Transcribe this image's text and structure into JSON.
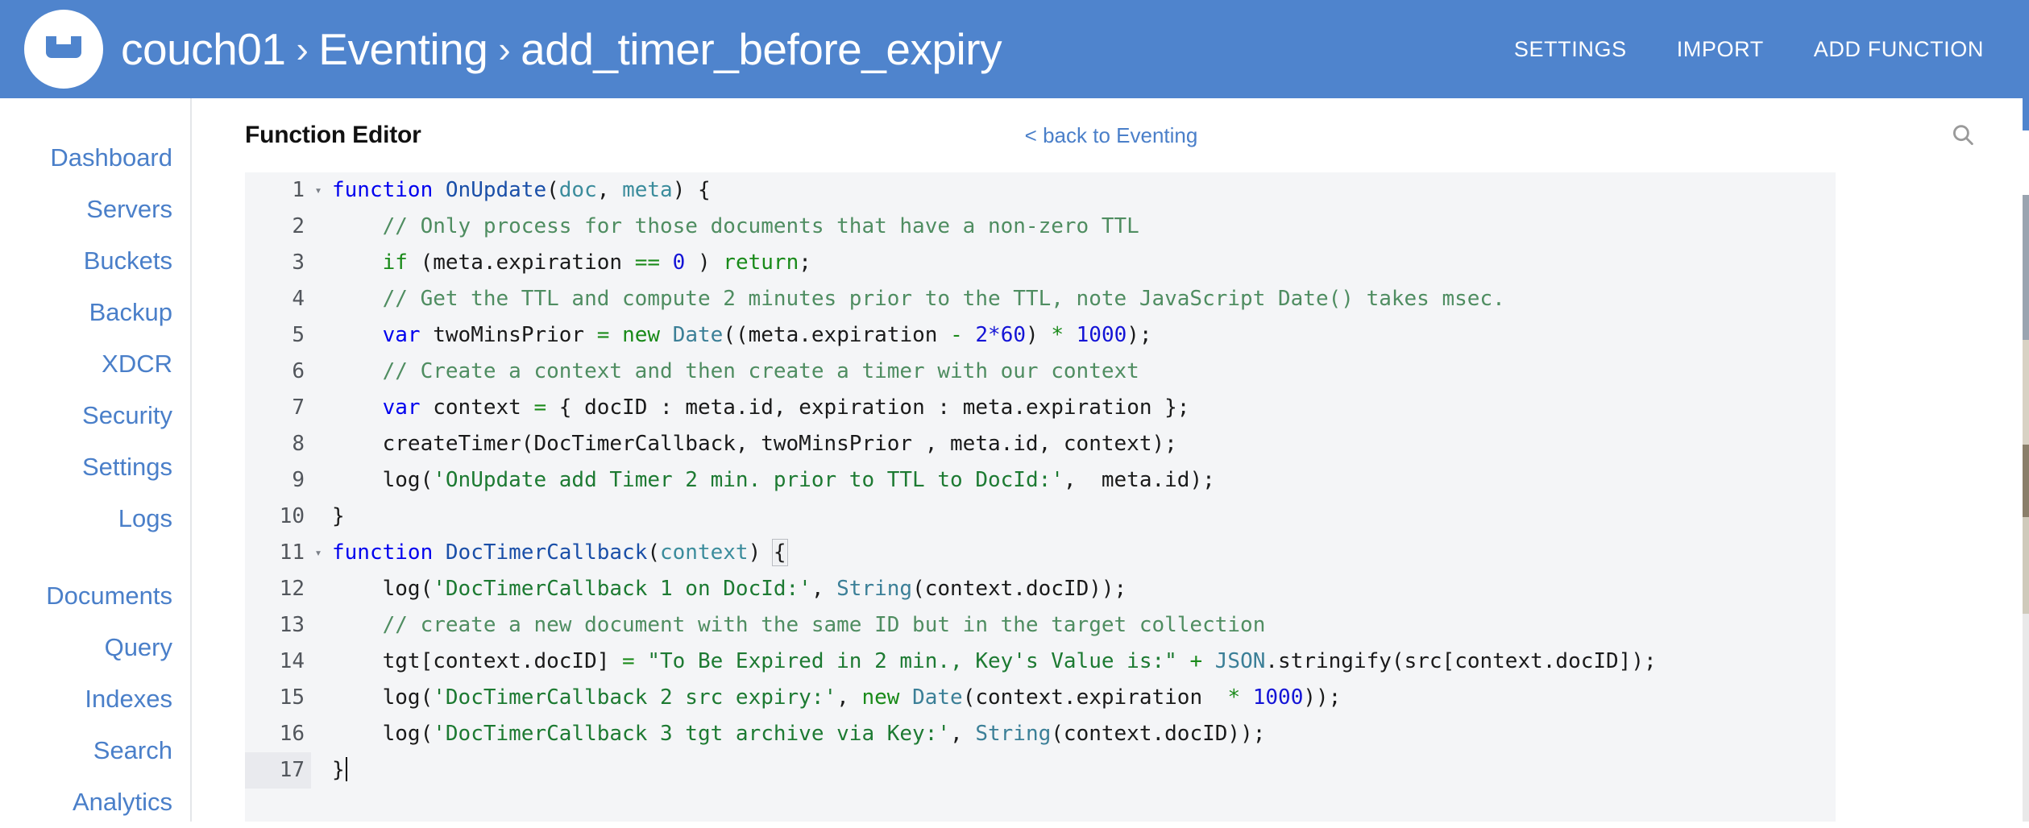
{
  "header": {
    "logo_icon": "couchbase-logo-icon",
    "breadcrumb": {
      "cluster": "couch01",
      "section": "Eventing",
      "function": "add_timer_before_expiry",
      "separator": "›"
    },
    "actions": [
      {
        "label": "SETTINGS",
        "name": "settings-button"
      },
      {
        "label": "IMPORT",
        "name": "import-button"
      },
      {
        "label": "ADD FUNCTION",
        "name": "add-function-button"
      }
    ],
    "accent_color": "#4f84cd"
  },
  "sidebar": {
    "items": [
      {
        "label": "Dashboard"
      },
      {
        "label": "Servers"
      },
      {
        "label": "Buckets"
      },
      {
        "label": "Backup"
      },
      {
        "label": "XDCR"
      },
      {
        "label": "Security"
      },
      {
        "label": "Settings"
      },
      {
        "label": "Logs"
      }
    ],
    "items2": [
      {
        "label": "Documents"
      },
      {
        "label": "Query"
      },
      {
        "label": "Indexes"
      },
      {
        "label": "Search"
      },
      {
        "label": "Analytics"
      }
    ],
    "link_color": "#4a7fc9"
  },
  "main": {
    "page_title": "Function Editor",
    "back_link": "< back to Eventing",
    "search_icon": "search-icon"
  },
  "editor": {
    "active_line": 17,
    "cursor_line": 17,
    "background": "#f4f5f7",
    "lines": [
      {
        "n": 1,
        "fold": true,
        "segments": [
          {
            "t": "function",
            "c": "tk-kw"
          },
          {
            "t": " ",
            "c": "tk-pl"
          },
          {
            "t": "OnUpdate",
            "c": "tk-fn"
          },
          {
            "t": "(",
            "c": "tk-pl"
          },
          {
            "t": "doc",
            "c": "tk-param"
          },
          {
            "t": ", ",
            "c": "tk-pl"
          },
          {
            "t": "meta",
            "c": "tk-param"
          },
          {
            "t": ") {",
            "c": "tk-pl"
          }
        ]
      },
      {
        "n": 2,
        "fold": false,
        "segments": [
          {
            "t": "    // Only process for those documents that have a non-zero TTL",
            "c": "tk-com"
          }
        ]
      },
      {
        "n": 3,
        "fold": false,
        "segments": [
          {
            "t": "    ",
            "c": "tk-pl"
          },
          {
            "t": "if",
            "c": "tk-kw2"
          },
          {
            "t": " (meta.expiration ",
            "c": "tk-pl"
          },
          {
            "t": "==",
            "c": "tk-op"
          },
          {
            "t": " ",
            "c": "tk-pl"
          },
          {
            "t": "0",
            "c": "tk-num"
          },
          {
            "t": " ) ",
            "c": "tk-pl"
          },
          {
            "t": "return",
            "c": "tk-kw2"
          },
          {
            "t": ";",
            "c": "tk-pl"
          }
        ]
      },
      {
        "n": 4,
        "fold": false,
        "segments": [
          {
            "t": "    // Get the TTL and compute 2 minutes prior to the TTL, note JavaScript Date() takes msec.",
            "c": "tk-com"
          }
        ]
      },
      {
        "n": 5,
        "fold": false,
        "segments": [
          {
            "t": "    ",
            "c": "tk-pl"
          },
          {
            "t": "var",
            "c": "tk-kw"
          },
          {
            "t": " twoMinsPrior ",
            "c": "tk-pl"
          },
          {
            "t": "=",
            "c": "tk-op"
          },
          {
            "t": " ",
            "c": "tk-pl"
          },
          {
            "t": "new",
            "c": "tk-kw2"
          },
          {
            "t": " ",
            "c": "tk-pl"
          },
          {
            "t": "Date",
            "c": "tk-type"
          },
          {
            "t": "((meta.expiration ",
            "c": "tk-pl"
          },
          {
            "t": "-",
            "c": "tk-op"
          },
          {
            "t": " ",
            "c": "tk-pl"
          },
          {
            "t": "2*60",
            "c": "tk-num"
          },
          {
            "t": ") ",
            "c": "tk-pl"
          },
          {
            "t": "*",
            "c": "tk-op"
          },
          {
            "t": " ",
            "c": "tk-pl"
          },
          {
            "t": "1000",
            "c": "tk-num"
          },
          {
            "t": ");",
            "c": "tk-pl"
          }
        ]
      },
      {
        "n": 6,
        "fold": false,
        "segments": [
          {
            "t": "    // Create a context and then create a timer with our context",
            "c": "tk-com"
          }
        ]
      },
      {
        "n": 7,
        "fold": false,
        "segments": [
          {
            "t": "    ",
            "c": "tk-pl"
          },
          {
            "t": "var",
            "c": "tk-kw"
          },
          {
            "t": " context ",
            "c": "tk-pl"
          },
          {
            "t": "=",
            "c": "tk-op"
          },
          {
            "t": " { docID : meta.id, expiration : meta.expiration };",
            "c": "tk-pl"
          }
        ]
      },
      {
        "n": 8,
        "fold": false,
        "segments": [
          {
            "t": "    createTimer(DocTimerCallback, twoMinsPrior , meta.id, context);",
            "c": "tk-pl"
          }
        ]
      },
      {
        "n": 9,
        "fold": false,
        "segments": [
          {
            "t": "    log(",
            "c": "tk-pl"
          },
          {
            "t": "'OnUpdate add Timer 2 min. prior to TTL to DocId:'",
            "c": "tk-str"
          },
          {
            "t": ",  meta.id);",
            "c": "tk-pl"
          }
        ]
      },
      {
        "n": 10,
        "fold": false,
        "segments": [
          {
            "t": "}",
            "c": "tk-pl"
          }
        ]
      },
      {
        "n": 11,
        "fold": true,
        "segments": [
          {
            "t": "function",
            "c": "tk-kw"
          },
          {
            "t": " ",
            "c": "tk-pl"
          },
          {
            "t": "DocTimerCallback",
            "c": "tk-fn"
          },
          {
            "t": "(",
            "c": "tk-pl"
          },
          {
            "t": "context",
            "c": "tk-param"
          },
          {
            "t": ") ",
            "c": "tk-pl"
          },
          {
            "t": "{",
            "c": "tk-pl brace-match"
          }
        ]
      },
      {
        "n": 12,
        "fold": false,
        "segments": [
          {
            "t": "    log(",
            "c": "tk-pl"
          },
          {
            "t": "'DocTimerCallback 1 on DocId:'",
            "c": "tk-str"
          },
          {
            "t": ", ",
            "c": "tk-pl"
          },
          {
            "t": "String",
            "c": "tk-type"
          },
          {
            "t": "(context.docID));",
            "c": "tk-pl"
          }
        ]
      },
      {
        "n": 13,
        "fold": false,
        "segments": [
          {
            "t": "    // create a new document with the same ID but in the target collection",
            "c": "tk-com"
          }
        ]
      },
      {
        "n": 14,
        "fold": false,
        "segments": [
          {
            "t": "    tgt[context.docID] ",
            "c": "tk-pl"
          },
          {
            "t": "=",
            "c": "tk-op"
          },
          {
            "t": " ",
            "c": "tk-pl"
          },
          {
            "t": "\"To Be Expired in 2 min., Key's Value is:\"",
            "c": "tk-str"
          },
          {
            "t": " ",
            "c": "tk-pl"
          },
          {
            "t": "+",
            "c": "tk-op"
          },
          {
            "t": " ",
            "c": "tk-pl"
          },
          {
            "t": "JSON",
            "c": "tk-type"
          },
          {
            "t": ".stringify(src[context.docID]);",
            "c": "tk-pl"
          }
        ]
      },
      {
        "n": 15,
        "fold": false,
        "segments": [
          {
            "t": "    log(",
            "c": "tk-pl"
          },
          {
            "t": "'DocTimerCallback 2 src expiry:'",
            "c": "tk-str"
          },
          {
            "t": ", ",
            "c": "tk-pl"
          },
          {
            "t": "new",
            "c": "tk-kw2"
          },
          {
            "t": " ",
            "c": "tk-pl"
          },
          {
            "t": "Date",
            "c": "tk-type"
          },
          {
            "t": "(context.expiration  ",
            "c": "tk-pl"
          },
          {
            "t": "*",
            "c": "tk-op"
          },
          {
            "t": " ",
            "c": "tk-pl"
          },
          {
            "t": "1000",
            "c": "tk-num"
          },
          {
            "t": "));",
            "c": "tk-pl"
          }
        ]
      },
      {
        "n": 16,
        "fold": false,
        "segments": [
          {
            "t": "    log(",
            "c": "tk-pl"
          },
          {
            "t": "'DocTimerCallback 3 tgt archive via Key:'",
            "c": "tk-str"
          },
          {
            "t": ", ",
            "c": "tk-pl"
          },
          {
            "t": "String",
            "c": "tk-type"
          },
          {
            "t": "(context.docID));",
            "c": "tk-pl"
          }
        ]
      },
      {
        "n": 17,
        "fold": false,
        "caret": true,
        "segments": [
          {
            "t": "}",
            "c": "tk-pl"
          }
        ]
      }
    ]
  }
}
